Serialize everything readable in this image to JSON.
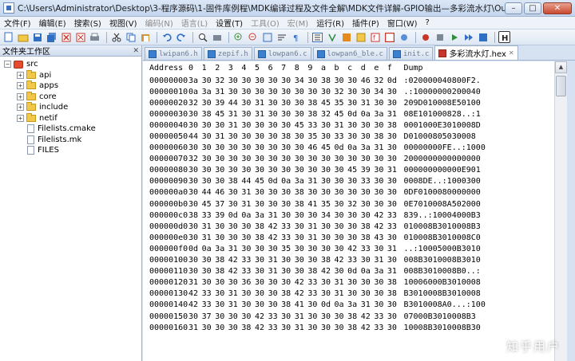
{
  "window": {
    "title": "C:\\Users\\Administrator\\Desktop\\3-程序源码\\1-固件库例程\\MDK编译过程及文件全解\\MDK文件详解-GPIO输出—多彩流水灯\\Output\\多彩流水灯.h...",
    "minimize": "–",
    "maximize": "□",
    "close": "✕"
  },
  "menu": [
    {
      "label": "文件(F)",
      "disabled": false
    },
    {
      "label": "编辑(E)",
      "disabled": false
    },
    {
      "label": "搜索(S)",
      "disabled": false
    },
    {
      "label": "视图(V)",
      "disabled": false
    },
    {
      "label": "编码(N)",
      "disabled": true
    },
    {
      "label": "语言(L)",
      "disabled": true
    },
    {
      "label": "设置(T)",
      "disabled": false
    },
    {
      "label": "工具(O)",
      "disabled": true
    },
    {
      "label": "宏(M)",
      "disabled": true
    },
    {
      "label": "运行(R)",
      "disabled": false
    },
    {
      "label": "插件(P)",
      "disabled": false
    },
    {
      "label": "窗口(W)",
      "disabled": false
    },
    {
      "label": "?",
      "disabled": false
    }
  ],
  "toolbar": {
    "colors": {
      "blue": "#2f6fc4",
      "green": "#2e8b3a",
      "red": "#c9352b",
      "orange": "#e48a1f",
      "gray": "#7d8896"
    }
  },
  "left_panel": {
    "title": "文件夹工作区",
    "close": "✕",
    "root": "src",
    "items": [
      {
        "label": "api",
        "type": "folder"
      },
      {
        "label": "apps",
        "type": "folder"
      },
      {
        "label": "core",
        "type": "folder"
      },
      {
        "label": "include",
        "type": "folder"
      },
      {
        "label": "netif",
        "type": "folder"
      },
      {
        "label": "Filelists.cmake",
        "type": "file"
      },
      {
        "label": "Filelists.mk",
        "type": "file"
      },
      {
        "label": "FILES",
        "type": "file"
      }
    ]
  },
  "tabs": [
    {
      "label": "lwipan6.h",
      "active": false
    },
    {
      "label": "zepif.h",
      "active": false
    },
    {
      "label": "lowpan6.c",
      "active": false
    },
    {
      "label": "lowpan6_ble.c",
      "active": false
    },
    {
      "label": "init.c",
      "active": false
    },
    {
      "label": "多彩流水灯.hex",
      "active": true
    }
  ],
  "hex": {
    "header": {
      "address": "Address",
      "cols": [
        "0",
        "1",
        "2",
        "3",
        "4",
        "5",
        "6",
        "7",
        "8",
        "9",
        "a",
        "b",
        "c",
        "d",
        "e",
        "f"
      ],
      "dump": "Dump"
    },
    "rows": [
      {
        "addr": "00000000",
        "bytes": [
          "3a",
          "30",
          "32",
          "30",
          "30",
          "30",
          "30",
          "30",
          "34",
          "30",
          "38",
          "30",
          "30",
          "46",
          "32",
          "0d"
        ],
        "dump": ":020000040800F2."
      },
      {
        "addr": "00000010",
        "bytes": [
          "0a",
          "3a",
          "31",
          "30",
          "30",
          "30",
          "30",
          "30",
          "30",
          "30",
          "30",
          "32",
          "30",
          "30",
          "34",
          "30"
        ],
        "dump": ".:10000000200040"
      },
      {
        "addr": "00000020",
        "bytes": [
          "32",
          "30",
          "39",
          "44",
          "30",
          "31",
          "30",
          "30",
          "30",
          "38",
          "45",
          "35",
          "30",
          "31",
          "30",
          "30"
        ],
        "dump": "209D010008E50100"
      },
      {
        "addr": "00000030",
        "bytes": [
          "30",
          "38",
          "45",
          "31",
          "30",
          "31",
          "30",
          "30",
          "30",
          "38",
          "32",
          "45",
          "0d",
          "0a",
          "3a",
          "31"
        ],
        "dump": "08E101000828..:1"
      },
      {
        "addr": "00000040",
        "bytes": [
          "30",
          "30",
          "30",
          "31",
          "30",
          "30",
          "30",
          "30",
          "45",
          "33",
          "30",
          "31",
          "30",
          "30",
          "30",
          "38"
        ],
        "dump": "0001000E3010008D"
      },
      {
        "addr": "00000050",
        "bytes": [
          "44",
          "30",
          "31",
          "30",
          "30",
          "30",
          "30",
          "38",
          "30",
          "35",
          "30",
          "33",
          "30",
          "30",
          "38",
          "30"
        ],
        "dump": "D01000805030008"
      },
      {
        "addr": "00000060",
        "bytes": [
          "30",
          "30",
          "30",
          "30",
          "30",
          "30",
          "30",
          "30",
          "30",
          "46",
          "45",
          "0d",
          "0a",
          "3a",
          "31",
          "30"
        ],
        "dump": "00000000FE..:1000"
      },
      {
        "addr": "00000070",
        "bytes": [
          "32",
          "30",
          "30",
          "30",
          "30",
          "30",
          "30",
          "30",
          "30",
          "30",
          "30",
          "30",
          "30",
          "30",
          "30",
          "30"
        ],
        "dump": "2000000000000000"
      },
      {
        "addr": "00000080",
        "bytes": [
          "30",
          "30",
          "30",
          "30",
          "30",
          "30",
          "30",
          "30",
          "30",
          "30",
          "30",
          "30",
          "45",
          "39",
          "30",
          "31"
        ],
        "dump": "000000000000E901"
      },
      {
        "addr": "00000090",
        "bytes": [
          "30",
          "30",
          "30",
          "38",
          "44",
          "45",
          "0d",
          "0a",
          "3a",
          "31",
          "30",
          "30",
          "30",
          "33",
          "30",
          "30"
        ],
        "dump": "0008DE..:1000300"
      },
      {
        "addr": "000000a0",
        "bytes": [
          "30",
          "44",
          "46",
          "30",
          "31",
          "30",
          "30",
          "30",
          "38",
          "30",
          "30",
          "30",
          "30",
          "30",
          "30",
          "30"
        ],
        "dump": "0DF0100080000000"
      },
      {
        "addr": "000000b0",
        "bytes": [
          "30",
          "45",
          "37",
          "30",
          "31",
          "30",
          "30",
          "30",
          "38",
          "41",
          "35",
          "30",
          "32",
          "30",
          "30",
          "30"
        ],
        "dump": "0E7010008A502000"
      },
      {
        "addr": "000000c0",
        "bytes": [
          "38",
          "33",
          "39",
          "0d",
          "0a",
          "3a",
          "31",
          "30",
          "30",
          "30",
          "34",
          "30",
          "30",
          "30",
          "42",
          "33"
        ],
        "dump": "839..:10004000B3"
      },
      {
        "addr": "000000d0",
        "bytes": [
          "30",
          "31",
          "30",
          "30",
          "30",
          "38",
          "42",
          "33",
          "30",
          "31",
          "30",
          "30",
          "30",
          "38",
          "42",
          "33"
        ],
        "dump": "010008B3010008B3"
      },
      {
        "addr": "000000e0",
        "bytes": [
          "30",
          "31",
          "30",
          "30",
          "30",
          "38",
          "42",
          "33",
          "30",
          "31",
          "30",
          "30",
          "30",
          "38",
          "43",
          "30"
        ],
        "dump": "010008B3010008C0"
      },
      {
        "addr": "000000f0",
        "bytes": [
          "0d",
          "0a",
          "3a",
          "31",
          "30",
          "30",
          "30",
          "35",
          "30",
          "30",
          "30",
          "30",
          "42",
          "33",
          "30",
          "31"
        ],
        "dump": "..:10005000B3010"
      },
      {
        "addr": "00000100",
        "bytes": [
          "30",
          "30",
          "38",
          "42",
          "33",
          "30",
          "31",
          "30",
          "30",
          "30",
          "38",
          "42",
          "33",
          "30",
          "31",
          "30"
        ],
        "dump": "008B3010008B3010"
      },
      {
        "addr": "00000110",
        "bytes": [
          "30",
          "30",
          "38",
          "42",
          "33",
          "30",
          "31",
          "30",
          "30",
          "38",
          "42",
          "30",
          "0d",
          "0a",
          "3a",
          "31"
        ],
        "dump": "008B3010008B0..:"
      },
      {
        "addr": "00000120",
        "bytes": [
          "31",
          "30",
          "30",
          "30",
          "36",
          "30",
          "30",
          "30",
          "42",
          "33",
          "30",
          "31",
          "30",
          "30",
          "30",
          "38"
        ],
        "dump": "10006000B3010008"
      },
      {
        "addr": "00000130",
        "bytes": [
          "42",
          "33",
          "30",
          "31",
          "30",
          "30",
          "30",
          "38",
          "42",
          "33",
          "30",
          "31",
          "30",
          "30",
          "30",
          "38"
        ],
        "dump": "B3010008B3010008"
      },
      {
        "addr": "00000140",
        "bytes": [
          "42",
          "33",
          "30",
          "31",
          "30",
          "30",
          "30",
          "38",
          "41",
          "30",
          "0d",
          "0a",
          "3a",
          "31",
          "30",
          "30"
        ],
        "dump": "B3010008A0...:100"
      },
      {
        "addr": "00000150",
        "bytes": [
          "30",
          "37",
          "30",
          "30",
          "30",
          "42",
          "33",
          "30",
          "31",
          "30",
          "30",
          "30",
          "38",
          "42",
          "33",
          "30"
        ],
        "dump": "07000B3010008B3"
      },
      {
        "addr": "00000160",
        "bytes": [
          "31",
          "30",
          "30",
          "30",
          "38",
          "42",
          "33",
          "30",
          "31",
          "30",
          "30",
          "30",
          "38",
          "42",
          "33",
          "30"
        ],
        "dump": "10008B3010008B30"
      }
    ]
  },
  "scrollbar": {
    "up": "▲"
  },
  "watermark": "知乎用户"
}
